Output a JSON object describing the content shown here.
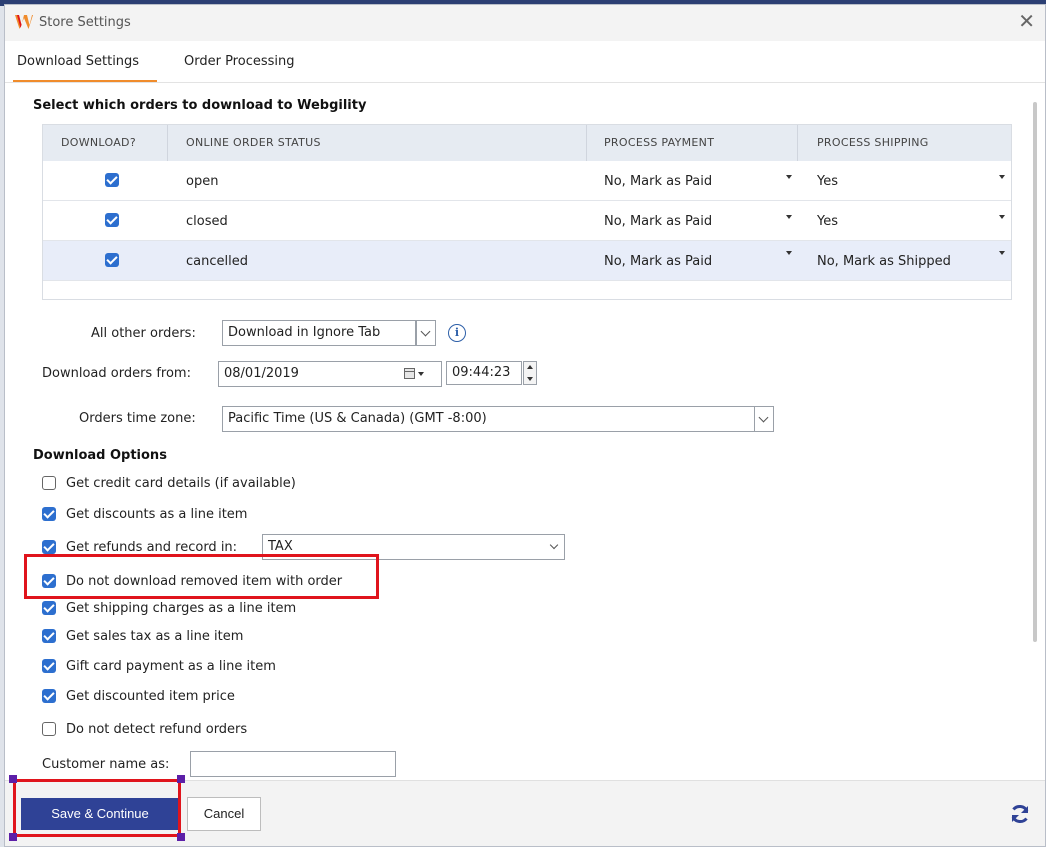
{
  "window": {
    "title": "Store Settings",
    "close_label": "✕"
  },
  "tabs": [
    {
      "label": "Download Settings",
      "active": true
    },
    {
      "label": "Order Processing",
      "active": false
    }
  ],
  "orders_section": {
    "heading": "Select which orders to download to Webgility",
    "columns": [
      "DOWNLOAD?",
      "ONLINE ORDER STATUS",
      "PROCESS PAYMENT",
      "PROCESS SHIPPING"
    ],
    "rows": [
      {
        "download": true,
        "status": "open",
        "payment": "No, Mark as Paid",
        "shipping": "Yes",
        "selected": false
      },
      {
        "download": true,
        "status": "closed",
        "payment": "No, Mark as Paid",
        "shipping": "Yes",
        "selected": false
      },
      {
        "download": true,
        "status": "cancelled",
        "payment": "No, Mark as Paid",
        "shipping": "No, Mark as Shipped",
        "selected": true
      }
    ]
  },
  "other_orders": {
    "label": "All other orders:",
    "value": "Download in Ignore Tab",
    "info_icon": "info-icon"
  },
  "download_from": {
    "label": "Download orders from:",
    "date": "08/01/2019",
    "time": "09:44:23"
  },
  "time_zone": {
    "label": "Orders time zone:",
    "value": "Pacific Time (US & Canada) (GMT -8:00)"
  },
  "download_options": {
    "heading": "Download Options",
    "options": [
      {
        "label": "Get credit card details (if available)",
        "checked": false
      },
      {
        "label": "Get discounts as a line item",
        "checked": true
      },
      {
        "label": "Get refunds and record in:",
        "checked": true
      },
      {
        "label": "Do not download removed item with order",
        "checked": true
      },
      {
        "label": "Get shipping charges as a line item",
        "checked": true
      },
      {
        "label": "Get sales tax as a line item",
        "checked": true
      },
      {
        "label": "Gift card payment as a line item",
        "checked": true
      },
      {
        "label": "Get discounted item price",
        "checked": true
      },
      {
        "label": "Do not detect refund orders",
        "checked": false
      }
    ],
    "refund_record_value": "TAX"
  },
  "customer_name": {
    "label": "Customer name as:",
    "value": ""
  },
  "footer": {
    "save_label": "Save & Continue",
    "cancel_label": "Cancel",
    "refresh_icon": "refresh-icon"
  },
  "colors": {
    "accent_tab": "#f08c2c",
    "primary_button": "#2f4296",
    "checkbox": "#2d6fcf",
    "highlight": "#e0141c"
  }
}
